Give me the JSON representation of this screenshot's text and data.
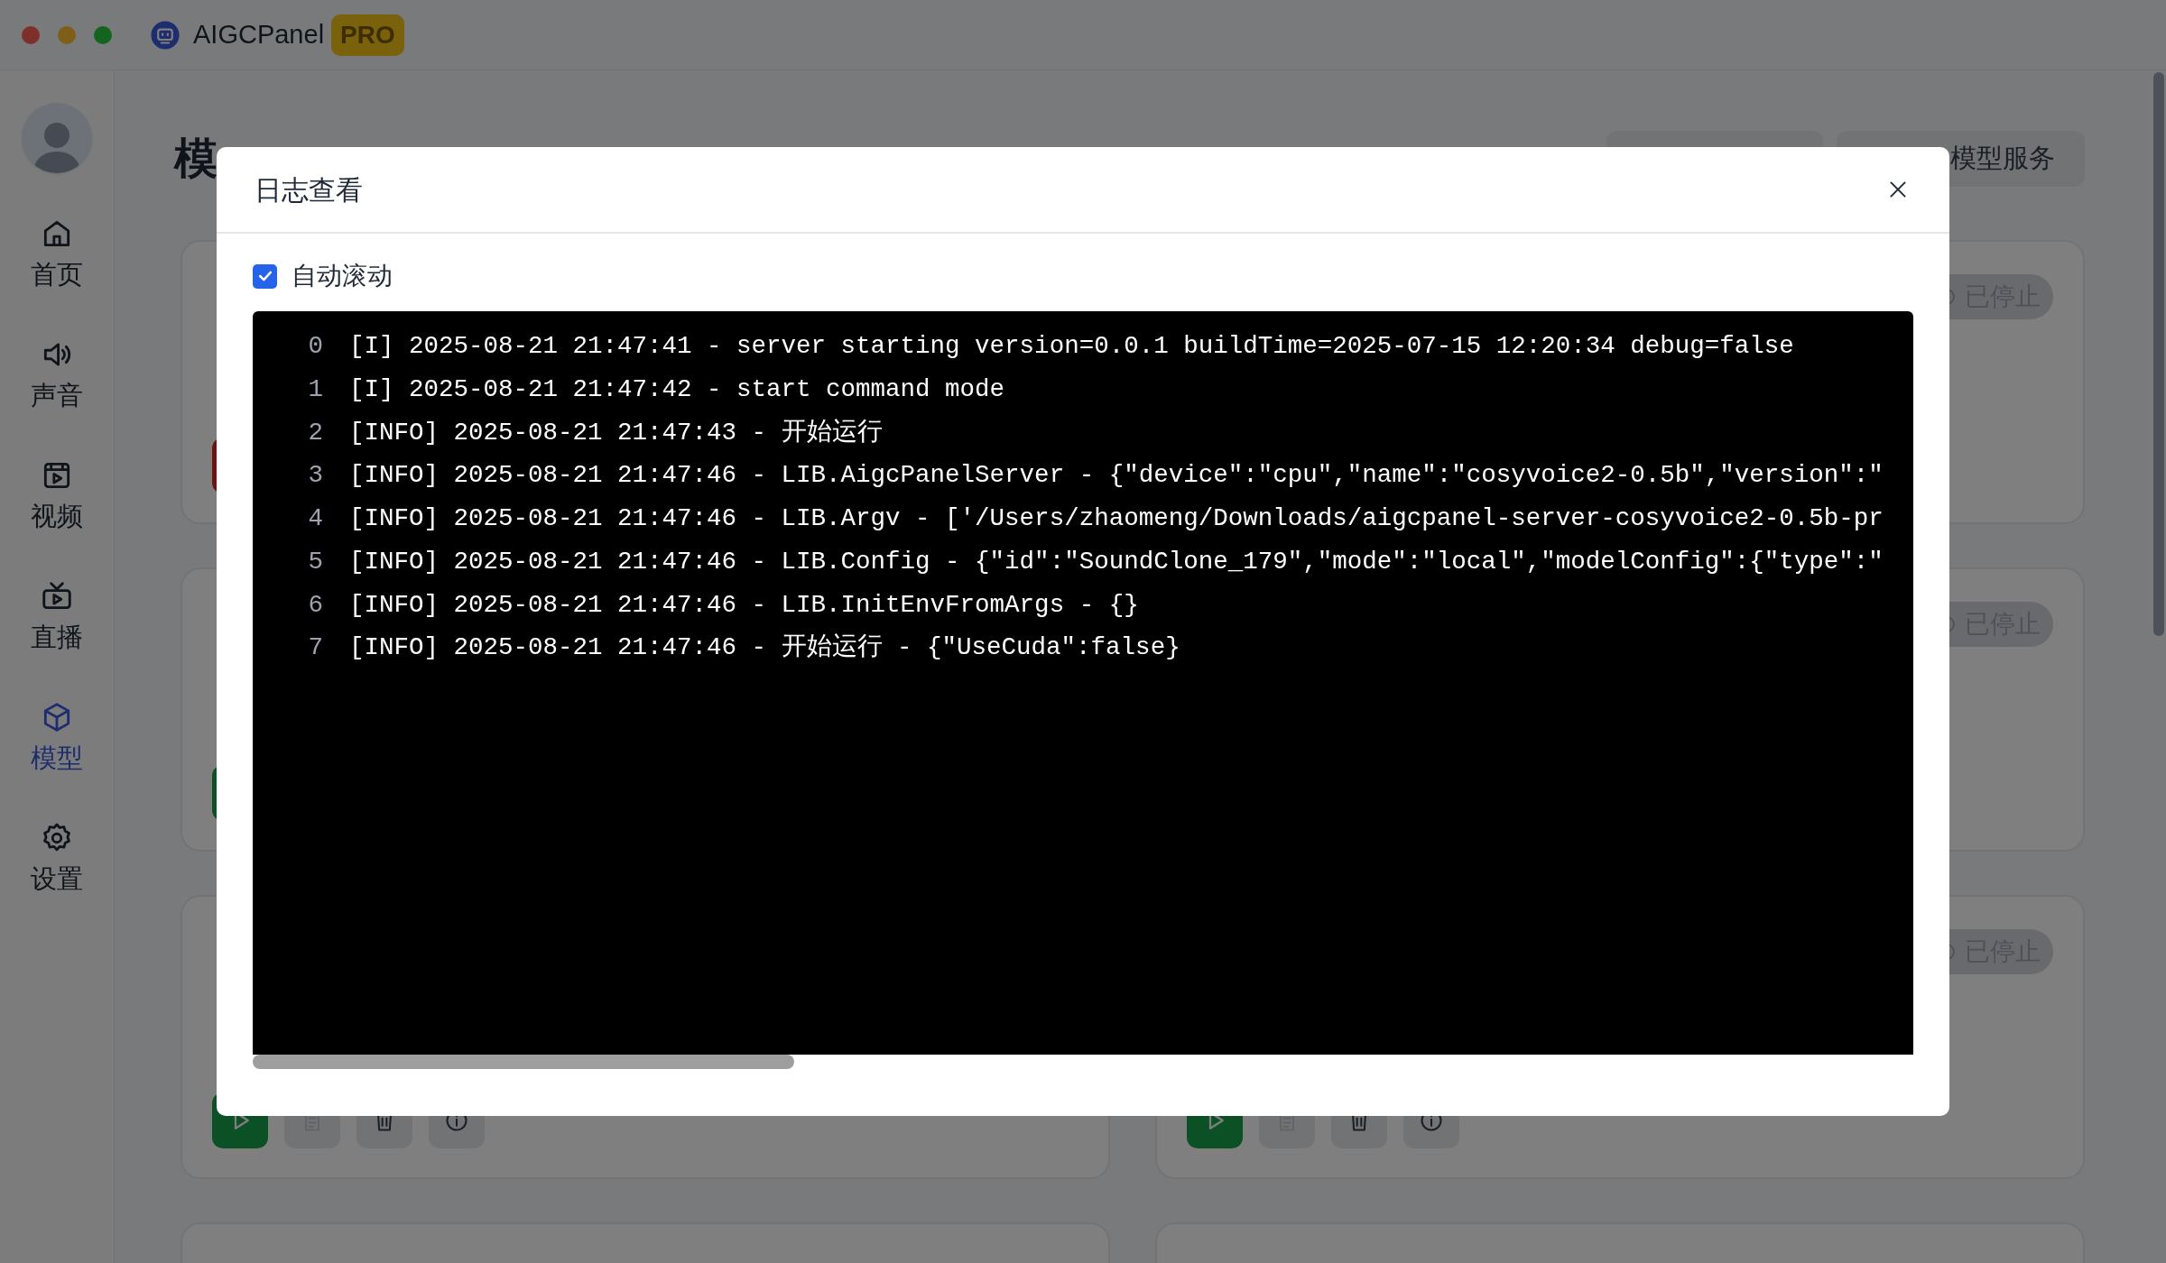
{
  "window": {
    "title": "AIGCPanel",
    "badge": "PRO"
  },
  "sidebar": {
    "items": [
      {
        "label": "首页",
        "selected": false
      },
      {
        "label": "声音",
        "selected": false
      },
      {
        "label": "视频",
        "selected": false
      },
      {
        "label": "直播",
        "selected": false
      },
      {
        "label": "模型",
        "selected": true
      },
      {
        "label": "设置",
        "selected": false
      }
    ]
  },
  "page": {
    "title": "模",
    "header_button": "模型服务"
  },
  "cards": [
    {
      "kind": "stop"
    },
    {
      "status": "已停止"
    },
    {
      "kind": "start"
    },
    {
      "status": "已停止"
    },
    {
      "kind": "start"
    },
    {
      "kind": "start",
      "status": "已停止"
    }
  ],
  "dialog": {
    "title": "日志查看",
    "auto_scroll": {
      "label": "自动滚动",
      "checked": true
    },
    "log": [
      {
        "number": "0",
        "text": "[I] 2025-08-21 21:47:41 - server starting version=0.0.1 buildTime=2025-07-15 12:20:34 debug=false"
      },
      {
        "number": "1",
        "text": "[I] 2025-08-21 21:47:42 - start command mode"
      },
      {
        "number": "2",
        "text": "[INFO] 2025-08-21 21:47:43 - 开始运行"
      },
      {
        "number": "3",
        "text": "[INFO] 2025-08-21 21:47:46 - LIB.AigcPanelServer - {\"device\":\"cpu\",\"name\":\"cosyvoice2-0.5b\",\"version\":\""
      },
      {
        "number": "4",
        "text": "[INFO] 2025-08-21 21:47:46 - LIB.Argv - ['/Users/zhaomeng/Downloads/aigcpanel-server-cosyvoice2-0.5b-pr"
      },
      {
        "number": "5",
        "text": "[INFO] 2025-08-21 21:47:46 - LIB.Config - {\"id\":\"SoundClone_179\",\"mode\":\"local\",\"modelConfig\":{\"type\":\""
      },
      {
        "number": "6",
        "text": "[INFO] 2025-08-21 21:47:46 - LIB.InitEnvFromArgs - {}"
      },
      {
        "number": "7",
        "text": "[INFO] 2025-08-21 21:47:46 - 开始运行 - {\"UseCuda\":false}"
      }
    ]
  }
}
